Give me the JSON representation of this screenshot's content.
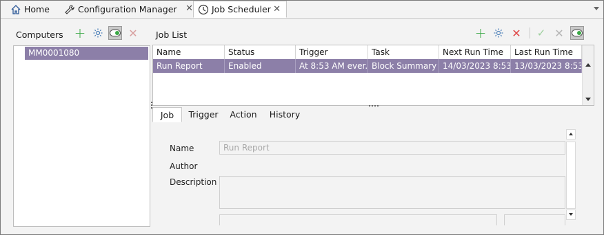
{
  "tabs": [
    {
      "label": "Home",
      "icon": "home-icon"
    },
    {
      "label": "Configuration Manager",
      "icon": "wrench-icon"
    },
    {
      "label": "Job Scheduler",
      "icon": "clock-icon",
      "active": true
    }
  ],
  "computers": {
    "title": "Computers",
    "items": [
      "MM0001080"
    ]
  },
  "job_list": {
    "title": "Job List",
    "columns": [
      "Name",
      "Status",
      "Trigger",
      "Task",
      "Next Run Time",
      "Last Run Time"
    ],
    "rows": [
      [
        "Run Report",
        "Enabled",
        "At 8:53 AM ever...",
        "Block Summary",
        "14/03/2023 8:53:...",
        "13/03/2023 8:53:..."
      ]
    ]
  },
  "detail_tabs": [
    "Job",
    "Trigger",
    "Action",
    "History"
  ],
  "form": {
    "name_label": "Name",
    "name_value": "Run Report",
    "author_label": "Author",
    "description_label": "Description"
  },
  "colors": {
    "selection": "#8c7fa8",
    "add": "#3aa845",
    "delete": "#e04848"
  }
}
